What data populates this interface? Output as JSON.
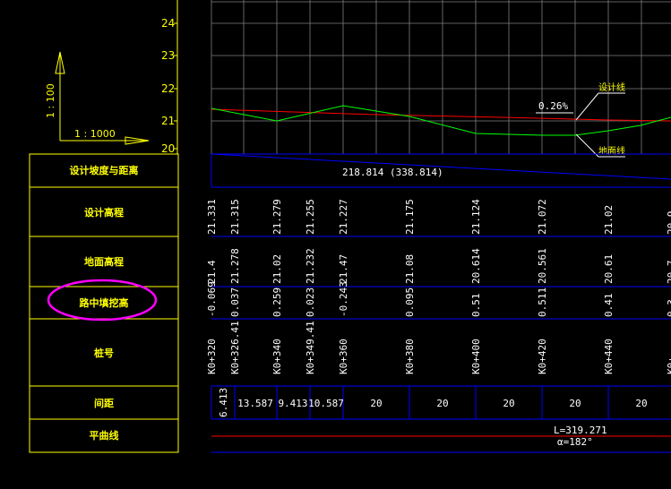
{
  "colors": {
    "background": "#000000",
    "yellow": "#ffff00",
    "grid": "#7f7f7f",
    "blue": "#0000ff",
    "red": "#ff0000",
    "green": "#00ff00",
    "white": "#ffffff",
    "magenta": "#ff00ff"
  },
  "axis": {
    "ticks": [
      "24",
      "23",
      "22",
      "21",
      "20"
    ],
    "vertical_scale": "1 : 100",
    "horizontal_scale": "1 : 1000"
  },
  "profile": {
    "design_line_label": "设计线",
    "ground_line_label": "地面线",
    "grade_label": "0.26%",
    "slope_distance": "218.814 (338.814)",
    "curve_length": "L=319.271",
    "curve_angle": "α=182°"
  },
  "rows": {
    "slope": "设计坡度与距离",
    "design": "设计高程",
    "ground": "地面高程",
    "fill": "路中填挖高",
    "station": "桩号",
    "spacing": "间距",
    "curve": "平曲线"
  },
  "design_values": [
    "21.331",
    "21.315",
    "21.279",
    "21.255",
    "21.227",
    "21.175",
    "21.124",
    "21.072",
    "21.02",
    "20.9…"
  ],
  "ground_values": [
    "21.4",
    "21.278",
    "21.02",
    "21.232",
    "21.47",
    "21.08",
    "20.614",
    "20.561",
    "20.61",
    "20.7…"
  ],
  "fill_values": [
    "-0.069",
    "0.037",
    "0.259",
    "0.023",
    "-0.243",
    "0.095",
    "0.51",
    "0.511",
    "0.41",
    "0.3…"
  ],
  "stations": [
    "K0+320",
    "K0+326.41",
    "K0+340",
    "K0+349.41",
    "K0+360",
    "K0+380",
    "K0+400",
    "K0+420",
    "K0+440",
    "K0+…"
  ],
  "spacings": [
    "6.413",
    "13.587",
    "9.413",
    "10.587",
    "20",
    "20",
    "20",
    "20",
    "20"
  ]
}
